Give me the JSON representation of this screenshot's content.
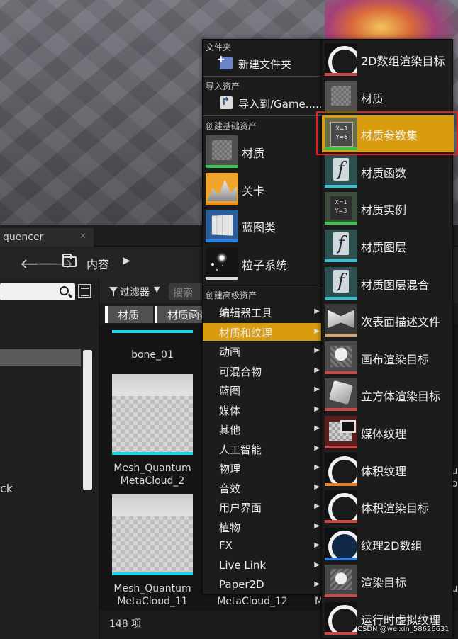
{
  "tab": {
    "label": "quencer"
  },
  "nav": {
    "breadcrumb": "内容"
  },
  "left_panel": {
    "tree_text": "ck"
  },
  "filter_bar": {
    "filter_label": "过滤器",
    "search_placeholder": "搜索"
  },
  "filter_chips": [
    "材质",
    "材质函数"
  ],
  "assets": {
    "tiles": [
      {
        "name": "bone_01"
      },
      {
        "name": "Mesh_Quantum MetaCloud_2"
      },
      {
        "name": "Mesh_Quantum MetaCloud_11"
      },
      {
        "name": "MetaCloud_12"
      }
    ],
    "count": "148 项",
    "cut_chars": [
      "u",
      "o",
      "u",
      "M"
    ]
  },
  "watermark": "CSDN @weixin_58626631",
  "main_menu": {
    "sections": {
      "folder": "文件夹",
      "import": "导入资产",
      "basic": "创建基础资产",
      "advanced": "创建高级资产"
    },
    "new_folder": "新建文件夹",
    "import_to": "导入到/Game......",
    "basic_items": [
      {
        "label": "材质",
        "icon": "material-icon"
      },
      {
        "label": "关卡",
        "icon": "level-icon"
      },
      {
        "label": "蓝图类",
        "icon": "blueprint-icon"
      },
      {
        "label": "粒子系统",
        "icon": "particle-system-icon"
      }
    ],
    "advanced_items": [
      "编辑器工具",
      "材质和纹理",
      "动画",
      "可混合物",
      "蓝图",
      "媒体",
      "其他",
      "人工智能",
      "物理",
      "音效",
      "用户界面",
      "植物",
      "FX",
      "Live Link",
      "Paper2D"
    ],
    "selected_advanced": "材质和纹理"
  },
  "sub_menu": {
    "items": [
      {
        "label": "2D数组渲染目标",
        "icon": "render-target-2d-array-icon"
      },
      {
        "label": "材质",
        "icon": "material-icon"
      },
      {
        "label": "材质参数集",
        "icon": "material-parameter-collection-icon"
      },
      {
        "label": "材质函数",
        "icon": "material-function-icon"
      },
      {
        "label": "材质实例",
        "icon": "material-instance-icon"
      },
      {
        "label": "材质图层",
        "icon": "material-layer-icon"
      },
      {
        "label": "材质图层混合",
        "icon": "material-layer-blend-icon"
      },
      {
        "label": "次表面描述文件",
        "icon": "subsurface-profile-icon"
      },
      {
        "label": "画布渲染目标",
        "icon": "canvas-render-target-icon"
      },
      {
        "label": "立方体渲染目标",
        "icon": "cube-render-target-icon"
      },
      {
        "label": "媒体纹理",
        "icon": "media-texture-icon"
      },
      {
        "label": "体积纹理",
        "icon": "volume-texture-icon"
      },
      {
        "label": "体积渲染目标",
        "icon": "volume-render-target-icon"
      },
      {
        "label": "纹理2D数组",
        "icon": "texture-2d-array-icon"
      },
      {
        "label": "渲染目标",
        "icon": "render-target-icon"
      },
      {
        "label": "运行时虚拟纹理",
        "icon": "runtime-virtual-texture-icon"
      }
    ],
    "selected": "材质参数集"
  },
  "colors": {
    "menu_highlight": "#d89c0e",
    "annotation_box": "#e5201e",
    "asset_underline": "#17d4e8"
  }
}
